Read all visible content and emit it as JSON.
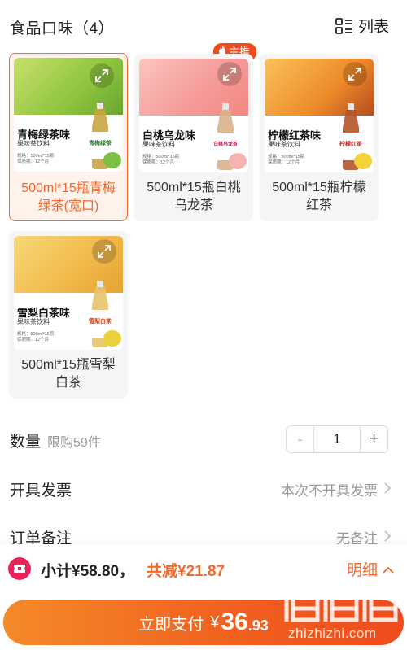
{
  "header": {
    "title": "食品口味（4）",
    "list_label": "列表"
  },
  "badge": {
    "label": "主推"
  },
  "products": [
    {
      "name": "青梅绿茶味",
      "subtitle": "果味茶饮料",
      "spec_line1": "规格：500ml*15瓶",
      "spec_line2": "保质期：12个月",
      "bottle_text": "青梅绿茶",
      "label_line1": "500ml*15瓶青梅",
      "label_line2": "绿茶(宽口)",
      "selected": true,
      "bg_color": "#9ccb4a",
      "fruit_color": "#7cc043"
    },
    {
      "name": "白桃乌龙味",
      "subtitle": "果味茶饮料",
      "spec_line1": "规格：500ml*15瓶",
      "spec_line2": "保质期：12个月",
      "bottle_text": "白桃乌龙茶",
      "label_line1": "500ml*15瓶白桃",
      "label_line2": "乌龙茶",
      "selected": false,
      "bg_color": "#f6a3a0",
      "fruit_color": "#f7b3b0"
    },
    {
      "name": "柠檬红茶味",
      "subtitle": "果味茶饮料",
      "spec_line1": "规格：500ml*15瓶",
      "spec_line2": "保质期：12个月",
      "bottle_text": "柠檬红茶",
      "label_line1": "500ml*15瓶柠檬",
      "label_line2": "红茶",
      "selected": false,
      "bg_color": "#f0a23a",
      "fruit_color": "#f4d23a"
    },
    {
      "name": "雪梨白茶味",
      "subtitle": "果味茶饮料",
      "spec_line1": "规格：500ml*15瓶",
      "spec_line2": "保质期：12个月",
      "bottle_text": "雪梨白茶",
      "label_line1": "500ml*15瓶雪梨",
      "label_line2": "白茶",
      "selected": false,
      "bg_color": "#f2c24a",
      "fruit_color": "#e9d23c"
    }
  ],
  "quantity": {
    "label": "数量",
    "limit_hint": "限购59件",
    "minus": "-",
    "value": "1",
    "plus": "+"
  },
  "invoice": {
    "label": "开具发票",
    "value": "本次不开具发票"
  },
  "remark": {
    "label": "订单备注",
    "value": "无备注"
  },
  "footer": {
    "subtotal": "小计¥58.80，",
    "discount": "共减¥21.87",
    "detail": "明细"
  },
  "pay": {
    "label": "立即支付",
    "currency": "¥",
    "amount_int": "36",
    "amount_dec": ".93"
  },
  "watermark": {
    "domain": "zhizhizhi.com"
  },
  "colors": {
    "accent": "#f26a2b",
    "badge": "#f24b1e",
    "coupon": "#e8245a"
  }
}
